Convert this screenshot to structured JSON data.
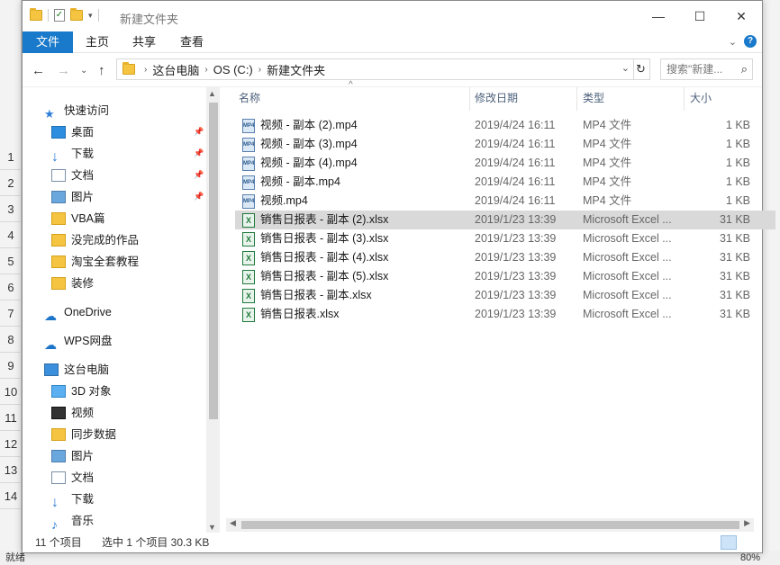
{
  "bg_excel": {
    "row_numbers": [
      "1",
      "2",
      "3",
      "4",
      "5",
      "6",
      "7",
      "8",
      "9",
      "10",
      "11",
      "12",
      "13",
      "14"
    ],
    "status_left": "就绪",
    "zoom": "80%"
  },
  "window": {
    "title": "新建文件夹",
    "controls": {
      "minimize": "—",
      "maximize": "☐",
      "close": "✕"
    }
  },
  "ribbon": {
    "tabs": [
      "文件",
      "主页",
      "共享",
      "查看"
    ]
  },
  "address": {
    "crumbs": [
      "这台电脑",
      "OS (C:)",
      "新建文件夹"
    ],
    "search_placeholder": "搜索\"新建...",
    "refresh": "↻"
  },
  "nav": {
    "quick_access": "快速访问",
    "quick_items": [
      {
        "label": "桌面",
        "icon": "desktop-icon",
        "pinned": true
      },
      {
        "label": "下载",
        "icon": "download-icon",
        "pinned": true
      },
      {
        "label": "文档",
        "icon": "document-icon",
        "pinned": true
      },
      {
        "label": "图片",
        "icon": "picture-icon",
        "pinned": true
      },
      {
        "label": "VBA篇",
        "icon": "folder-icon",
        "pinned": false
      },
      {
        "label": "没完成的作品",
        "icon": "folder-icon",
        "pinned": false
      },
      {
        "label": "淘宝全套教程",
        "icon": "folder-icon",
        "pinned": false
      },
      {
        "label": "装修",
        "icon": "folder-icon",
        "pinned": false
      }
    ],
    "onedrive": "OneDrive",
    "wps": "WPS网盘",
    "this_pc": "这台电脑",
    "pc_items": [
      {
        "label": "3D 对象",
        "icon": "3d-objects-icon"
      },
      {
        "label": "视频",
        "icon": "video-icon"
      },
      {
        "label": "同步数据",
        "icon": "folder-icon"
      },
      {
        "label": "图片",
        "icon": "picture-icon"
      },
      {
        "label": "文档",
        "icon": "document-icon"
      },
      {
        "label": "下载",
        "icon": "download-icon"
      },
      {
        "label": "音乐",
        "icon": "music-icon"
      }
    ]
  },
  "columns": {
    "name": "名称",
    "date": "修改日期",
    "type": "类型",
    "size": "大小"
  },
  "files": [
    {
      "name": "视频 - 副本 (2).mp4",
      "date": "2019/4/24 16:11",
      "type": "MP4 文件",
      "size": "1 KB",
      "kind": "mp4"
    },
    {
      "name": "视频 - 副本 (3).mp4",
      "date": "2019/4/24 16:11",
      "type": "MP4 文件",
      "size": "1 KB",
      "kind": "mp4"
    },
    {
      "name": "视频 - 副本 (4).mp4",
      "date": "2019/4/24 16:11",
      "type": "MP4 文件",
      "size": "1 KB",
      "kind": "mp4"
    },
    {
      "name": "视频 - 副本.mp4",
      "date": "2019/4/24 16:11",
      "type": "MP4 文件",
      "size": "1 KB",
      "kind": "mp4"
    },
    {
      "name": "视频.mp4",
      "date": "2019/4/24 16:11",
      "type": "MP4 文件",
      "size": "1 KB",
      "kind": "mp4"
    },
    {
      "name": "销售日报表 - 副本 (2).xlsx",
      "date": "2019/1/23 13:39",
      "type": "Microsoft Excel ...",
      "size": "31 KB",
      "kind": "xlsx"
    },
    {
      "name": "销售日报表 - 副本 (3).xlsx",
      "date": "2019/1/23 13:39",
      "type": "Microsoft Excel ...",
      "size": "31 KB",
      "kind": "xlsx"
    },
    {
      "name": "销售日报表 - 副本 (4).xlsx",
      "date": "2019/1/23 13:39",
      "type": "Microsoft Excel ...",
      "size": "31 KB",
      "kind": "xlsx"
    },
    {
      "name": "销售日报表 - 副本 (5).xlsx",
      "date": "2019/1/23 13:39",
      "type": "Microsoft Excel ...",
      "size": "31 KB",
      "kind": "xlsx"
    },
    {
      "name": "销售日报表 - 副本.xlsx",
      "date": "2019/1/23 13:39",
      "type": "Microsoft Excel ...",
      "size": "31 KB",
      "kind": "xlsx"
    },
    {
      "name": "销售日报表.xlsx",
      "date": "2019/1/23 13:39",
      "type": "Microsoft Excel ...",
      "size": "31 KB",
      "kind": "xlsx"
    }
  ],
  "selected_index": 5,
  "status": {
    "count": "11 个项目",
    "selection": "选中 1 个项目  30.3 KB"
  },
  "colors": {
    "accent": "#1979ca",
    "selected_row": "#d9d9d9"
  }
}
